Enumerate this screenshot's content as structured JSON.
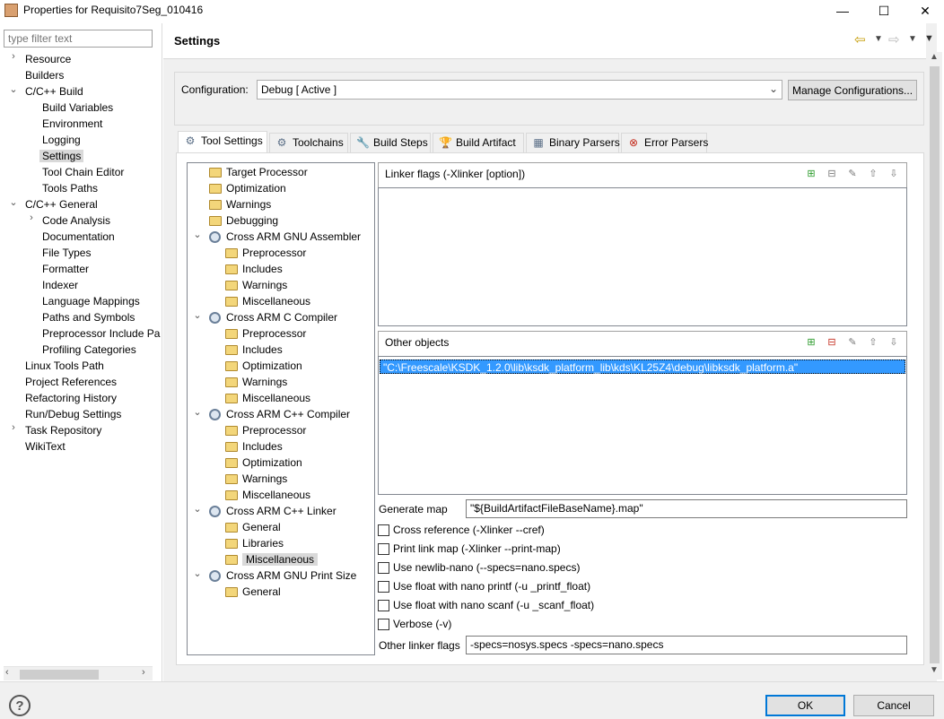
{
  "window": {
    "title": "Properties for Requisito7Seg_010416",
    "min": "—",
    "max": "☐",
    "close": "✕"
  },
  "filter": {
    "placeholder": "type filter text"
  },
  "nav": [
    {
      "label": "Resource",
      "indent": 0,
      "arrow": "›"
    },
    {
      "label": "Builders",
      "indent": 0,
      "arrow": ""
    },
    {
      "label": "C/C++ Build",
      "indent": 0,
      "arrow": "⌄"
    },
    {
      "label": "Build Variables",
      "indent": 1,
      "arrow": ""
    },
    {
      "label": "Environment",
      "indent": 1,
      "arrow": ""
    },
    {
      "label": "Logging",
      "indent": 1,
      "arrow": ""
    },
    {
      "label": "Settings",
      "indent": 1,
      "arrow": "",
      "selected": true
    },
    {
      "label": "Tool Chain Editor",
      "indent": 1,
      "arrow": ""
    },
    {
      "label": "Tools Paths",
      "indent": 1,
      "arrow": ""
    },
    {
      "label": "C/C++ General",
      "indent": 0,
      "arrow": "⌄"
    },
    {
      "label": "Code Analysis",
      "indent": 1,
      "arrow": "›"
    },
    {
      "label": "Documentation",
      "indent": 1,
      "arrow": ""
    },
    {
      "label": "File Types",
      "indent": 1,
      "arrow": ""
    },
    {
      "label": "Formatter",
      "indent": 1,
      "arrow": ""
    },
    {
      "label": "Indexer",
      "indent": 1,
      "arrow": ""
    },
    {
      "label": "Language Mappings",
      "indent": 1,
      "arrow": ""
    },
    {
      "label": "Paths and Symbols",
      "indent": 1,
      "arrow": ""
    },
    {
      "label": "Preprocessor Include Pa",
      "indent": 1,
      "arrow": ""
    },
    {
      "label": "Profiling Categories",
      "indent": 1,
      "arrow": ""
    },
    {
      "label": "Linux Tools Path",
      "indent": 0,
      "arrow": ""
    },
    {
      "label": "Project References",
      "indent": 0,
      "arrow": ""
    },
    {
      "label": "Refactoring History",
      "indent": 0,
      "arrow": ""
    },
    {
      "label": "Run/Debug Settings",
      "indent": 0,
      "arrow": ""
    },
    {
      "label": "Task Repository",
      "indent": 0,
      "arrow": "›"
    },
    {
      "label": "WikiText",
      "indent": 0,
      "arrow": ""
    }
  ],
  "settings": {
    "title": "Settings",
    "config_label": "Configuration:",
    "config_value": "Debug  [ Active ]",
    "manage_label": "Manage Configurations..."
  },
  "tabs": [
    {
      "label": "Tool Settings",
      "active": true,
      "icon": "gear-icon"
    },
    {
      "label": "Toolchains",
      "active": false,
      "icon": "gear-icon"
    },
    {
      "label": "Build Steps",
      "active": false,
      "icon": "wrench-icon"
    },
    {
      "label": "Build Artifact",
      "active": false,
      "icon": "trophy-icon"
    },
    {
      "label": "Binary Parsers",
      "active": false,
      "icon": "binary-icon"
    },
    {
      "label": "Error Parsers",
      "active": false,
      "icon": "error-icon"
    }
  ],
  "tool_tree": [
    {
      "label": "Target Processor",
      "level": 0,
      "type": "folder"
    },
    {
      "label": "Optimization",
      "level": 0,
      "type": "folder"
    },
    {
      "label": "Warnings",
      "level": 0,
      "type": "folder"
    },
    {
      "label": "Debugging",
      "level": 0,
      "type": "folder"
    },
    {
      "label": "Cross ARM GNU Assembler",
      "level": 0,
      "type": "tool"
    },
    {
      "label": "Preprocessor",
      "level": 1,
      "type": "folder"
    },
    {
      "label": "Includes",
      "level": 1,
      "type": "folder"
    },
    {
      "label": "Warnings",
      "level": 1,
      "type": "folder"
    },
    {
      "label": "Miscellaneous",
      "level": 1,
      "type": "folder"
    },
    {
      "label": "Cross ARM C Compiler",
      "level": 0,
      "type": "tool"
    },
    {
      "label": "Preprocessor",
      "level": 1,
      "type": "folder"
    },
    {
      "label": "Includes",
      "level": 1,
      "type": "folder"
    },
    {
      "label": "Optimization",
      "level": 1,
      "type": "folder"
    },
    {
      "label": "Warnings",
      "level": 1,
      "type": "folder"
    },
    {
      "label": "Miscellaneous",
      "level": 1,
      "type": "folder"
    },
    {
      "label": "Cross ARM C++ Compiler",
      "level": 0,
      "type": "tool"
    },
    {
      "label": "Preprocessor",
      "level": 1,
      "type": "folder"
    },
    {
      "label": "Includes",
      "level": 1,
      "type": "folder"
    },
    {
      "label": "Optimization",
      "level": 1,
      "type": "folder"
    },
    {
      "label": "Warnings",
      "level": 1,
      "type": "folder"
    },
    {
      "label": "Miscellaneous",
      "level": 1,
      "type": "folder"
    },
    {
      "label": "Cross ARM C++ Linker",
      "level": 0,
      "type": "tool"
    },
    {
      "label": "General",
      "level": 1,
      "type": "folder"
    },
    {
      "label": "Libraries",
      "level": 1,
      "type": "folder"
    },
    {
      "label": "Miscellaneous",
      "level": 1,
      "type": "folder",
      "selected": true
    },
    {
      "label": "Cross ARM GNU Print Size",
      "level": 0,
      "type": "tool"
    },
    {
      "label": "General",
      "level": 1,
      "type": "folder"
    }
  ],
  "linker": {
    "flags_title": "Linker flags (-Xlinker [option])",
    "objects_title": "Other objects",
    "objects_items": [
      "\"C:\\Freescale\\KSDK_1.2.0\\lib\\ksdk_platform_lib\\kds\\KL25Z4\\debug\\libksdk_platform.a\""
    ],
    "generate_map_label": "Generate map",
    "generate_map_value": "\"${BuildArtifactFileBaseName}.map\"",
    "checkboxes": [
      "Cross reference (-Xlinker --cref)",
      "Print link map (-Xlinker --print-map)",
      "Use newlib-nano (--specs=nano.specs)",
      "Use float with nano printf (-u _printf_float)",
      "Use float with nano scanf (-u _scanf_float)",
      "Verbose (-v)"
    ],
    "other_flags_label": "Other linker flags",
    "other_flags_value": "-specs=nosys.specs -specs=nano.specs"
  },
  "buttons": {
    "ok": "OK",
    "cancel": "Cancel",
    "help": "?"
  }
}
